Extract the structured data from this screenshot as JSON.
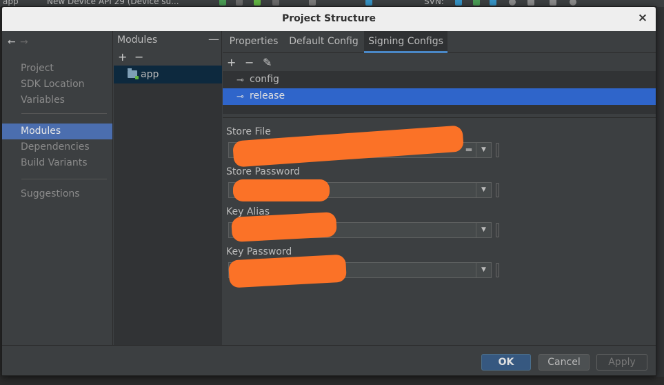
{
  "ide": {
    "run_config": "app",
    "device": "New Device API 29 (Device su...",
    "svn_label": "SVN:"
  },
  "dialog": {
    "title": "Project Structure",
    "close_glyph": "×"
  },
  "nav": {
    "back_glyph": "←",
    "forward_glyph": "→",
    "items": [
      {
        "label": "Project"
      },
      {
        "label": "SDK Location"
      },
      {
        "label": "Variables"
      },
      {
        "label": "Modules",
        "selected": true
      },
      {
        "label": "Dependencies"
      },
      {
        "label": "Build Variants"
      },
      {
        "label": "Suggestions"
      }
    ]
  },
  "modules": {
    "header": "Modules",
    "collapse_glyph": "—",
    "add_glyph": "+",
    "remove_glyph": "−",
    "items": [
      {
        "label": "app",
        "selected": true
      }
    ]
  },
  "tabs": [
    {
      "label": "Properties"
    },
    {
      "label": "Default Config"
    },
    {
      "label": "Signing Configs",
      "active": true
    }
  ],
  "signing": {
    "add_glyph": "+",
    "remove_glyph": "−",
    "edit_glyph": "✎",
    "key_glyph": "⊸",
    "configs": [
      {
        "label": "config"
      },
      {
        "label": "release",
        "selected": true
      }
    ],
    "fields": [
      {
        "label": "Store File",
        "value": ""
      },
      {
        "label": "Store Password",
        "value": ""
      },
      {
        "label": "Key Alias",
        "value": ""
      },
      {
        "label": "Key Password",
        "value": ""
      }
    ],
    "dropdown_glyph": "▼",
    "browse_glyph": "▬"
  },
  "buttons": {
    "ok": "OK",
    "cancel": "Cancel",
    "apply": "Apply"
  },
  "colors": {
    "selection": "#2f65ca",
    "nav_selection": "#4b6eaf",
    "redaction": "#fb7227",
    "primary_button": "#365880"
  }
}
